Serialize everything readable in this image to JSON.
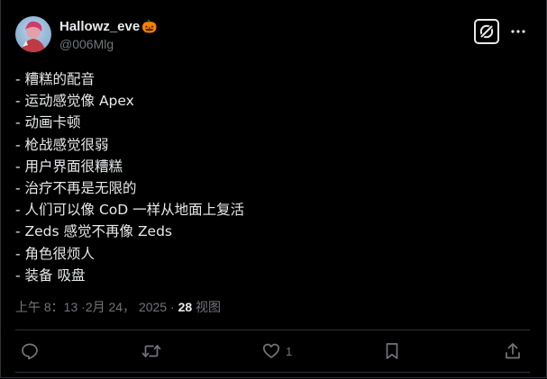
{
  "author": {
    "display_name": "Hallowz_eve",
    "name_emoji": "🎃",
    "handle": "@006Mlg"
  },
  "tweet": {
    "lines": [
      "- 糟糕的配音",
      "- 运动感觉像 Apex",
      "- 动画卡顿",
      "- 枪战感觉很弱",
      "- 用户界面很糟糕",
      "- 治疗不再是无限的",
      "- 人们可以像 CoD 一样从地面上复活",
      "- Zeds 感觉不再像 Zeds",
      "- 角色很烦人",
      "- 装备 吸盘"
    ]
  },
  "meta": {
    "time": "上午 8：13",
    "date": "2月 24， 2025",
    "views_count": "28",
    "views_label": "视图"
  },
  "actions": {
    "like_count": "1"
  },
  "icons": {
    "grok": "grok-icon",
    "more": "more-icon",
    "reply": "reply-icon",
    "repost": "repost-icon",
    "like": "heart-icon",
    "bookmark": "bookmark-icon",
    "share": "share-icon"
  },
  "colors": {
    "background": "#000000",
    "text": "#e7e9ea",
    "muted": "#71767b",
    "border": "#2f3336"
  }
}
